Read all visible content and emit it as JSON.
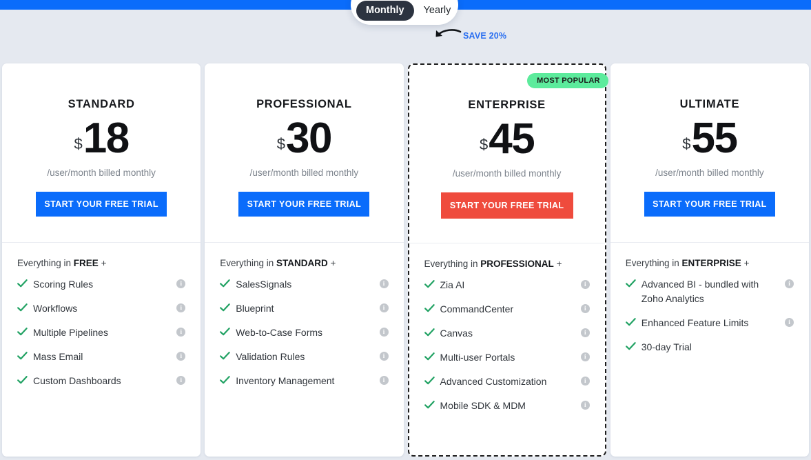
{
  "theme": {
    "top_bar_color": "#0a6cfb",
    "page_background": "#e5e9f0",
    "cta_color": "#0a6cfb",
    "cta_highlight_color": "#ef4b3d",
    "badge_color": "#5ceb9c",
    "check_color": "#21a263",
    "save_text_color": "#2b6ff0"
  },
  "billing_toggle": {
    "monthly_label": "Monthly",
    "yearly_label": "Yearly",
    "selected": "Monthly",
    "save_note": "SAVE 20%",
    "arrow_icon": "curved-arrow-left-icon"
  },
  "plans": [
    {
      "name": "STANDARD",
      "currency": "$",
      "price": "18",
      "billing_note": "/user/month billed monthly",
      "cta_label": "START YOUR FREE TRIAL",
      "cta_style": "primary",
      "popular": false,
      "badge_label": "",
      "inherits_prefix": "Everything in ",
      "inherits_plan": "FREE",
      "inherits_suffix": " +",
      "features": [
        {
          "label": "Scoring Rules",
          "has_info": true
        },
        {
          "label": "Workflows",
          "has_info": true
        },
        {
          "label": "Multiple Pipelines",
          "has_info": true
        },
        {
          "label": "Mass Email",
          "has_info": true
        },
        {
          "label": "Custom Dashboards",
          "has_info": true
        }
      ]
    },
    {
      "name": "PROFESSIONAL",
      "currency": "$",
      "price": "30",
      "billing_note": "/user/month billed monthly",
      "cta_label": "START YOUR FREE TRIAL",
      "cta_style": "primary",
      "popular": false,
      "badge_label": "",
      "inherits_prefix": "Everything in ",
      "inherits_plan": "STANDARD",
      "inherits_suffix": " +",
      "features": [
        {
          "label": "SalesSignals",
          "has_info": true
        },
        {
          "label": "Blueprint",
          "has_info": true
        },
        {
          "label": "Web-to-Case Forms",
          "has_info": true
        },
        {
          "label": "Validation Rules",
          "has_info": true
        },
        {
          "label": "Inventory Management",
          "has_info": true
        }
      ]
    },
    {
      "name": "ENTERPRISE",
      "currency": "$",
      "price": "45",
      "billing_note": "/user/month billed monthly",
      "cta_label": "START YOUR FREE TRIAL",
      "cta_style": "highlight",
      "popular": true,
      "badge_label": "MOST POPULAR",
      "inherits_prefix": "Everything in ",
      "inherits_plan": "PROFESSIONAL",
      "inherits_suffix": " +",
      "features": [
        {
          "label": "Zia AI",
          "has_info": true
        },
        {
          "label": "CommandCenter",
          "has_info": true
        },
        {
          "label": "Canvas",
          "has_info": true
        },
        {
          "label": "Multi-user Portals",
          "has_info": true
        },
        {
          "label": "Advanced Customization",
          "has_info": true
        },
        {
          "label": "Mobile SDK & MDM",
          "has_info": true
        }
      ]
    },
    {
      "name": "ULTIMATE",
      "currency": "$",
      "price": "55",
      "billing_note": "/user/month billed monthly",
      "cta_label": "START YOUR FREE TRIAL",
      "cta_style": "primary",
      "popular": false,
      "badge_label": "",
      "inherits_prefix": "Everything in ",
      "inherits_plan": "ENTERPRISE",
      "inherits_suffix": " +",
      "features": [
        {
          "label": "Advanced BI - bundled with Zoho Analytics",
          "has_info": true
        },
        {
          "label": "Enhanced Feature Limits",
          "has_info": true
        },
        {
          "label": "30-day Trial",
          "has_info": false
        }
      ]
    }
  ]
}
